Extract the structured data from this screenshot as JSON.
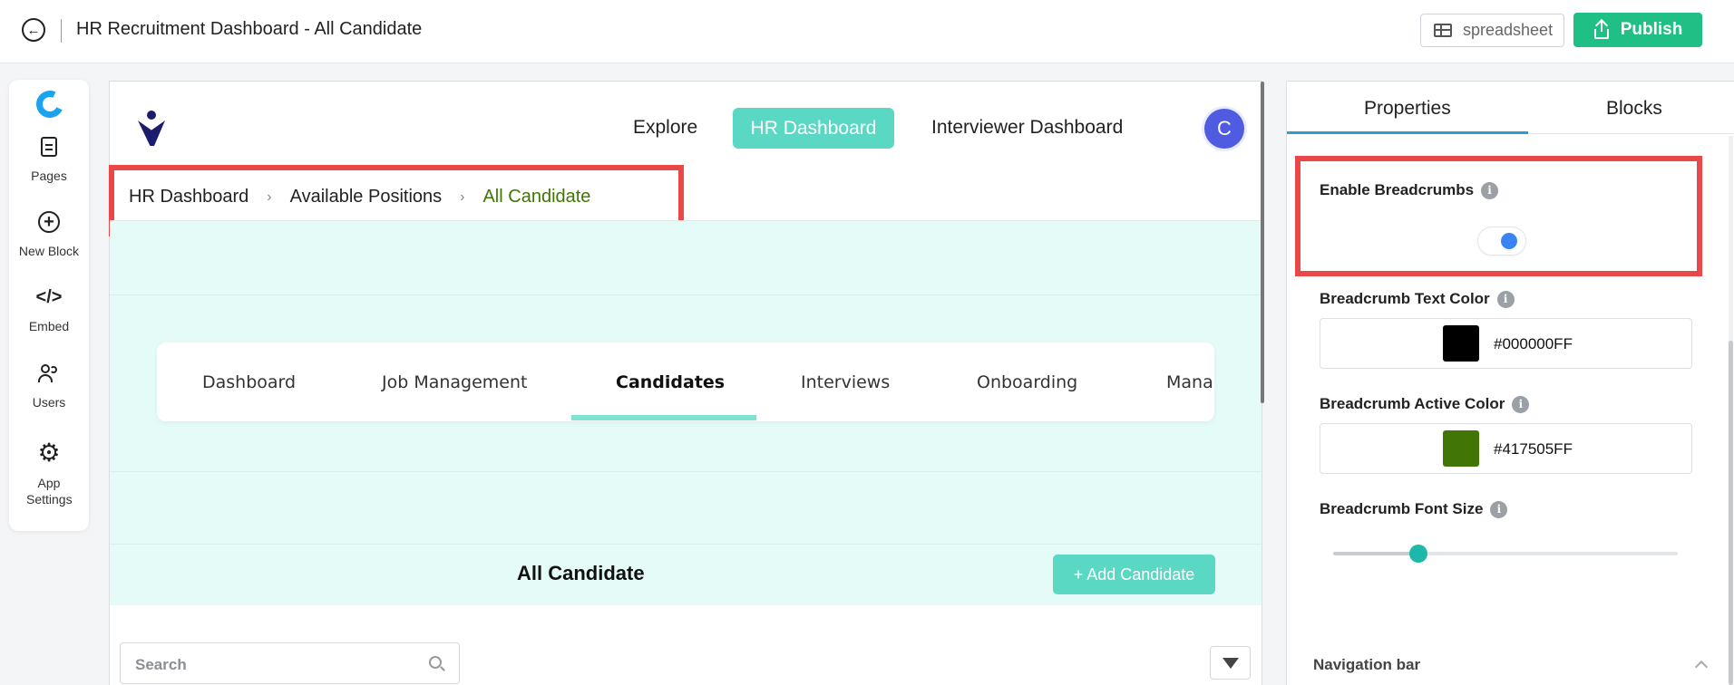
{
  "topbar": {
    "title": "HR Recruitment Dashboard - All Candidate",
    "spreadsheet_label": "spreadsheet",
    "publish_label": "Publish"
  },
  "sidebar": {
    "items": [
      {
        "label": "Pages",
        "icon": "pages-icon"
      },
      {
        "label": "New Block",
        "icon": "plus-circle-icon"
      },
      {
        "label": "Embed",
        "icon": "code-icon"
      },
      {
        "label": "Users",
        "icon": "users-icon"
      },
      {
        "label": "App Settings",
        "icon": "gear-icon"
      }
    ]
  },
  "page": {
    "nav": {
      "items": [
        "Explore",
        "HR Dashboard",
        "Interviewer Dashboard"
      ],
      "active": "HR Dashboard",
      "avatar_initial": "C"
    },
    "breadcrumb": [
      "HR Dashboard",
      "Available Positions",
      "All Candidate"
    ],
    "tabs": [
      "Dashboard",
      "Job Management",
      "Candidates",
      "Interviews",
      "Onboarding",
      "Mana"
    ],
    "active_tab": "Candidates",
    "section_title": "All Candidate",
    "add_button": "+ Add Candidate",
    "search_placeholder": "Search"
  },
  "panel": {
    "tabs": [
      "Properties",
      "Blocks"
    ],
    "active_tab": "Properties",
    "enable_breadcrumbs_label": "Enable Breadcrumbs",
    "enable_breadcrumbs": true,
    "text_color_label": "Breadcrumb Text Color",
    "text_color": "#000000FF",
    "active_color_label": "Breadcrumb Active Color",
    "active_color": "#417505FF",
    "font_size_label": "Breadcrumb Font Size",
    "font_size_slider_fraction": 0.25,
    "navigation_bar_label": "Navigation bar"
  },
  "colors": {
    "accent_teal": "#5ad8c4",
    "publish_green": "#1fbf85",
    "highlight_red": "#e94848",
    "breadcrumb_active": "#417505",
    "toggle_blue": "#3b82f6"
  }
}
